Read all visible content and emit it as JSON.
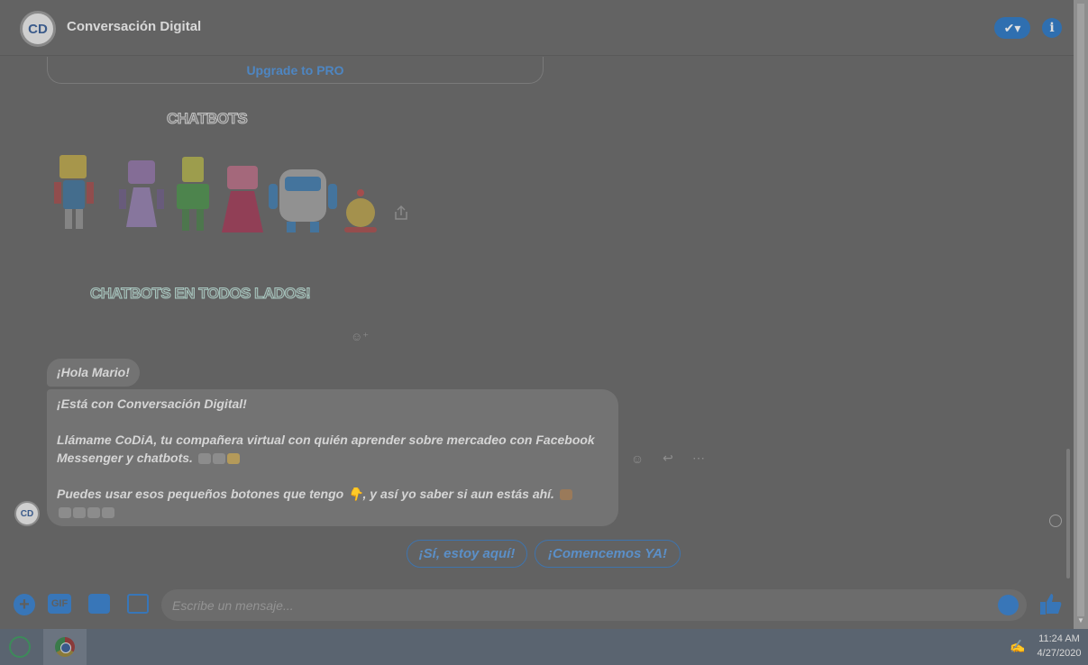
{
  "header": {
    "logo_text": "CD",
    "title": "Conversación Digital",
    "check_icon": "check-icon",
    "info_icon": "info-icon",
    "accent": "#2f6fb0"
  },
  "upgrade": {
    "label": "Upgrade to PRO"
  },
  "banner": {
    "title": "CHATBOTS",
    "subtitle": "CHATBOTS EN TODOS LADOS!"
  },
  "messages": {
    "greeting": "¡Hola Mario!",
    "line1": "¡Está con Conversación Digital!",
    "line2": "Llámame CoDiA, tu compañera virtual con quién aprender sobre mercadeo con Facebook Messenger y chatbots.",
    "line3": "Puedes usar esos pequeños botones que tengo 👇, y así yo saber si aun estás ahí."
  },
  "actions": {
    "react": "☺",
    "reply": "↩",
    "more": "⋯"
  },
  "quick_replies": [
    {
      "label": "¡Sí, estoy aquí!"
    },
    {
      "label": "¡Comencemos YA!"
    }
  ],
  "composer": {
    "plus": "+",
    "gif": "GIF",
    "placeholder": "Escribe un mensaje..."
  },
  "taskbar": {
    "time": "11:24 AM",
    "date": "4/27/2020"
  }
}
